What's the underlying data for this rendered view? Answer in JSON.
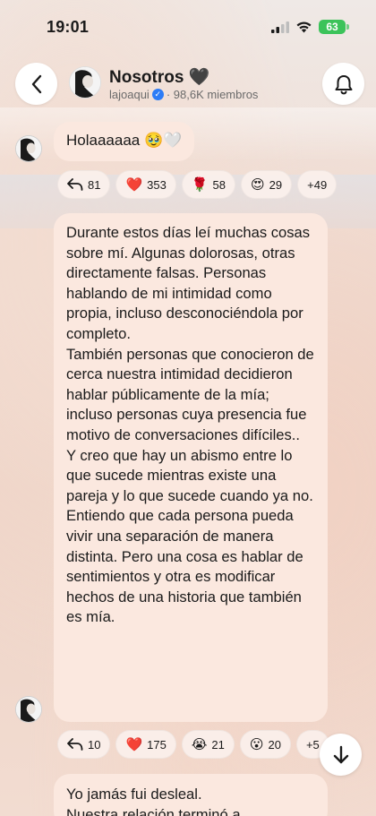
{
  "status_bar": {
    "time": "19:01",
    "battery": "63",
    "battery_color": "#3cc35a"
  },
  "header": {
    "title": "Nosotros 🖤",
    "handle": "lajoaqui",
    "members": "· 98,6K miembros",
    "back_icon": "chevron-left-icon",
    "bell_icon": "bell-icon"
  },
  "messages": [
    {
      "text": "Holaaaaaa 🥹🤍",
      "reactions": [
        {
          "icon": "reply-icon",
          "glyph": "↩",
          "count": "81"
        },
        {
          "icon": "red-heart-emoji",
          "glyph": "❤️",
          "count": "353"
        },
        {
          "icon": "rose-emoji",
          "glyph": "🌹",
          "count": "58"
        },
        {
          "icon": "heart-eyes-emoji",
          "glyph": "😍",
          "count": "29"
        },
        {
          "icon": "more",
          "glyph": "",
          "count": "+49"
        }
      ]
    },
    {
      "paragraphs": [
        "Durante estos días leí muchas cosas sobre mí. Algunas dolorosas, otras directamente falsas. Personas hablando de mi intimidad como propia, incluso desconociéndola por completo.",
        "También personas que conocieron de cerca nuestra intimidad decidieron hablar públicamente de la mía; incluso personas cuya presencia fue motivo de conversaciones difíciles..",
        "Y creo que hay un abismo entre lo que sucede mientras existe una pareja y lo que sucede cuando ya no.",
        "Entiendo que cada persona pueda vivir una separación de manera distinta. Pero una cosa es hablar de sentimientos y otra es modificar hechos de una historia que también es mía."
      ],
      "reactions": [
        {
          "icon": "reply-icon",
          "glyph": "↩",
          "count": "10"
        },
        {
          "icon": "red-heart-emoji",
          "glyph": "❤️",
          "count": "175"
        },
        {
          "icon": "crying-emoji",
          "glyph": "😭",
          "count": "21"
        },
        {
          "icon": "surprised-emoji",
          "glyph": "😮",
          "count": "20"
        },
        {
          "icon": "more",
          "glyph": "",
          "count": "+5"
        }
      ]
    },
    {
      "line1": "Yo jamás fui desleal.",
      "line2": "Nuestra relación terminó a"
    }
  ],
  "scroll_down_icon": "arrow-down-icon"
}
